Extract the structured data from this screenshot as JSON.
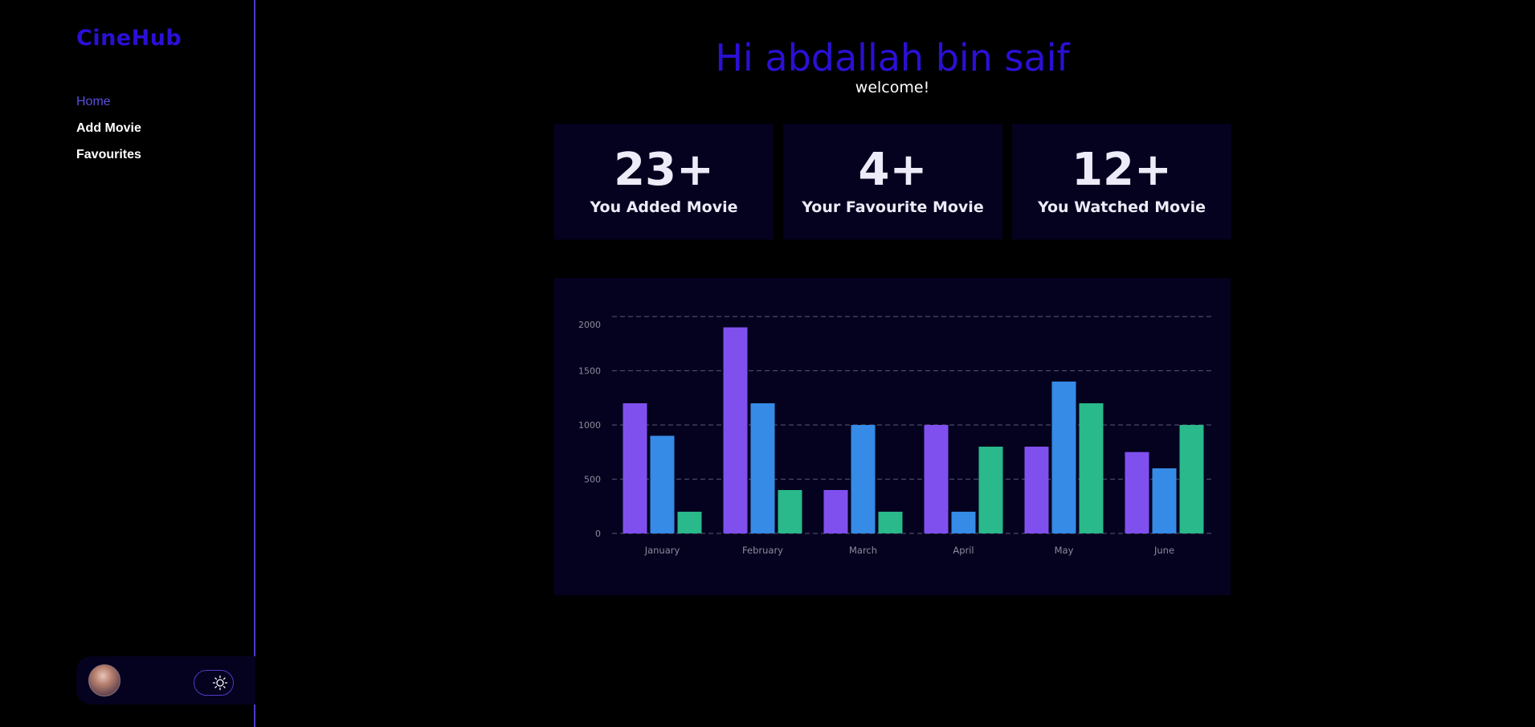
{
  "app": {
    "name": "CineHub"
  },
  "sidebar": {
    "items": [
      {
        "label": "Home",
        "active": true
      },
      {
        "label": "Add Movie",
        "active": false
      },
      {
        "label": "Favourites",
        "active": false
      }
    ]
  },
  "user_panel": {
    "avatar_icon": "user-avatar",
    "toggle_icon": "sun-icon"
  },
  "header": {
    "greeting": "Hi abdallah bin saif",
    "subtitle": "welcome!"
  },
  "stats": [
    {
      "value": "23+",
      "label": "You Added Movie"
    },
    {
      "value": "4+",
      "label": "Your Favourite Movie"
    },
    {
      "value": "12+",
      "label": "You Watched Movie"
    }
  ],
  "colors": {
    "brand": "#2a10d6",
    "active_nav": "#5a4fe0",
    "panel_bg": "#05021f",
    "accent_border": "#4b3cc9"
  },
  "chart_data": {
    "type": "bar",
    "categories": [
      "January",
      "February",
      "March",
      "April",
      "May",
      "June"
    ],
    "series": [
      {
        "color": "#8050ef",
        "values": [
          1200,
          1900,
          400,
          1000,
          800,
          750
        ]
      },
      {
        "color": "#358be6",
        "values": [
          900,
          1200,
          1000,
          200,
          1400,
          600
        ]
      },
      {
        "color": "#29b98a",
        "values": [
          200,
          400,
          200,
          800,
          1200,
          1000
        ]
      }
    ],
    "yticks": [
      0,
      500,
      1000,
      1500,
      2000
    ],
    "ylim": [
      0,
      2000
    ],
    "grid": true,
    "legend": "none"
  }
}
